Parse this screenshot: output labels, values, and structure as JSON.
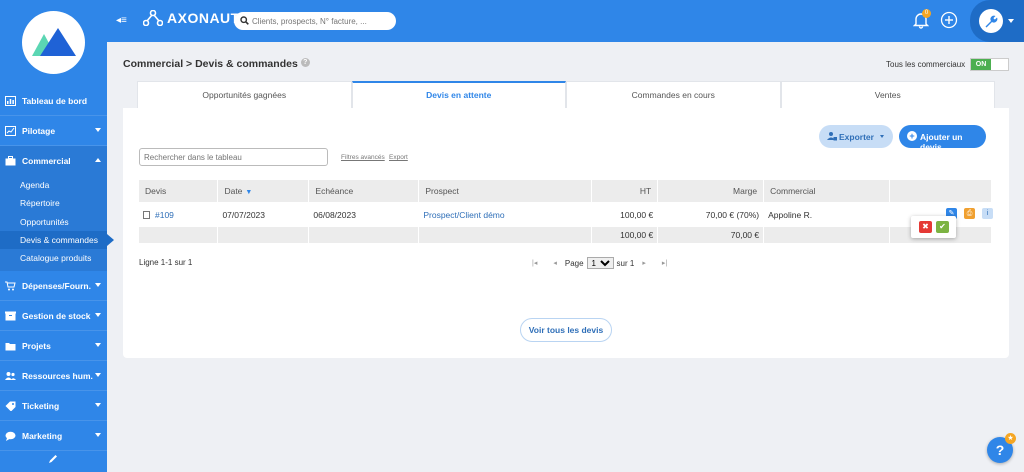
{
  "sidebar": {
    "items": [
      {
        "label": "Tableau de bord",
        "icon": "dashboard-icon"
      },
      {
        "label": "Pilotage",
        "icon": "chart-icon"
      },
      {
        "label": "Commercial",
        "icon": "briefcase-icon"
      },
      {
        "label": "Dépenses/Fourn.",
        "icon": "cart-icon"
      },
      {
        "label": "Gestion de stock",
        "icon": "box-icon"
      },
      {
        "label": "Projets",
        "icon": "folder-icon"
      },
      {
        "label": "Ressources hum.",
        "icon": "people-icon"
      },
      {
        "label": "Ticketing",
        "icon": "tag-icon"
      },
      {
        "label": "Marketing",
        "icon": "chat-icon"
      }
    ],
    "subitems": [
      "Agenda",
      "Répertoire",
      "Opportunités",
      "Devis & commandes",
      "Catalogue produits"
    ]
  },
  "header": {
    "brand": "AXONAUT",
    "search_placeholder": "Clients, prospects, N° facture, ...",
    "notif_count": "0"
  },
  "page": {
    "breadcrumb": "Commercial > Devis & commandes",
    "all_sales_label": "Tous les commerciaux",
    "toggle_label": "ON"
  },
  "tabs": [
    "Opportunités gagnées",
    "Devis en attente",
    "Commandes en cours",
    "Ventes"
  ],
  "toolbar": {
    "table_search_placeholder": "Rechercher dans le tableau",
    "advanced_filters": "Filtres avancés",
    "export_link": "Export",
    "export_button": "Exporter",
    "add_button": "Ajouter un devis"
  },
  "table": {
    "headers": [
      "Devis",
      "Date",
      "Echéance",
      "Prospect",
      "HT",
      "Marge",
      "Commercial"
    ],
    "rows": [
      {
        "devis": "#109",
        "date": "07/07/2023",
        "echeance": "06/08/2023",
        "prospect": "Prospect/Client démo",
        "ht": "100,00 €",
        "marge": "70,00 € (70%)",
        "commercial": "Appoline R."
      }
    ],
    "total": {
      "ht": "100,00 €",
      "marge": "70,00 €"
    }
  },
  "pagination": {
    "info": "Ligne 1-1 sur 1",
    "page_label": "Page",
    "page_value": "1",
    "of_label": "sur 1"
  },
  "see_all": "Voir tous les devis",
  "colors": {
    "primary": "#2f86e8",
    "sidebar": "#2f86e8",
    "on": "#4caf50",
    "reject": "#e53935",
    "accept": "#7cb342"
  }
}
